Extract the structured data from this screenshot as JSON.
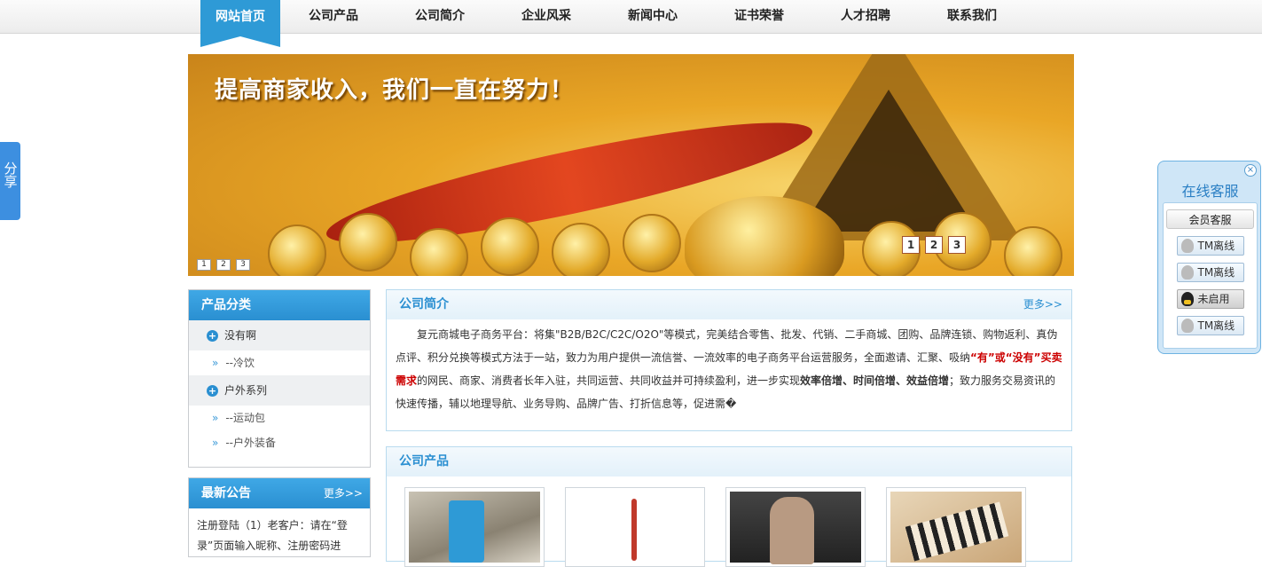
{
  "nav": {
    "items": [
      "网站首页",
      "公司产品",
      "公司简介",
      "企业风采",
      "新闻中心",
      "证书荣誉",
      "人才招聘",
      "联系我们"
    ]
  },
  "share": {
    "label": "分享"
  },
  "banner": {
    "title": "提高商家收入，我们一直在努力！",
    "dots_small": [
      "1",
      "2",
      "3"
    ],
    "dots_large": [
      "1",
      "2",
      "3"
    ]
  },
  "category": {
    "title": "产品分类",
    "groups": [
      {
        "label": "没有啊",
        "children": [
          "--冷饮"
        ]
      },
      {
        "label": "户外系列",
        "children": [
          "--运动包",
          "--户外装备"
        ]
      }
    ]
  },
  "notice": {
    "title": "最新公告",
    "more": "更多>>",
    "text": "注册登陆（1）老客户：请在“登录”页面输入昵称、注册密码进"
  },
  "intro": {
    "title": "公司简介",
    "more": "更多>>",
    "p1": "复元商城电子商务平台：将集\"B2B/B2C/C2C/O2O\"等模式，完美结合零售、批发、代销、二手商城、团购、品牌连锁、购物返利、真伪点评、积分兑换等模式方法于一站，致力为用户提供一流信誉、一流效率的电子商务平台运营服务，全面邀请、汇聚、吸纳",
    "red": "“有”或“没有”买卖需求",
    "p2": "的网民、商家、消费者长年入驻，共同运营、共同收益并可持续盈利，进一步实现",
    "bold": "效率倍增、时间倍增、效益倍增",
    "p3": "；致力服务交易资讯的快速传播，辅以地理导航、业务导购、品牌广告、打折信息等，促进需�"
  },
  "products": {
    "title": "公司产品",
    "items": [
      "product-sandal",
      "product-knot",
      "product-sunglasses",
      "product-keyboard"
    ]
  },
  "service": {
    "title": "在线客服",
    "group": "会员客服",
    "buttons": [
      {
        "label": "TM离线",
        "icon": "qq-gray-icon"
      },
      {
        "label": "TM离线",
        "icon": "qq-gray-icon"
      },
      {
        "label": "未启用",
        "icon": "qq-black-icon"
      },
      {
        "label": "TM离线",
        "icon": "qq-gray-icon"
      }
    ],
    "close": "×"
  },
  "colors": {
    "accent": "#2e9ad6",
    "red": "#cc0000"
  }
}
